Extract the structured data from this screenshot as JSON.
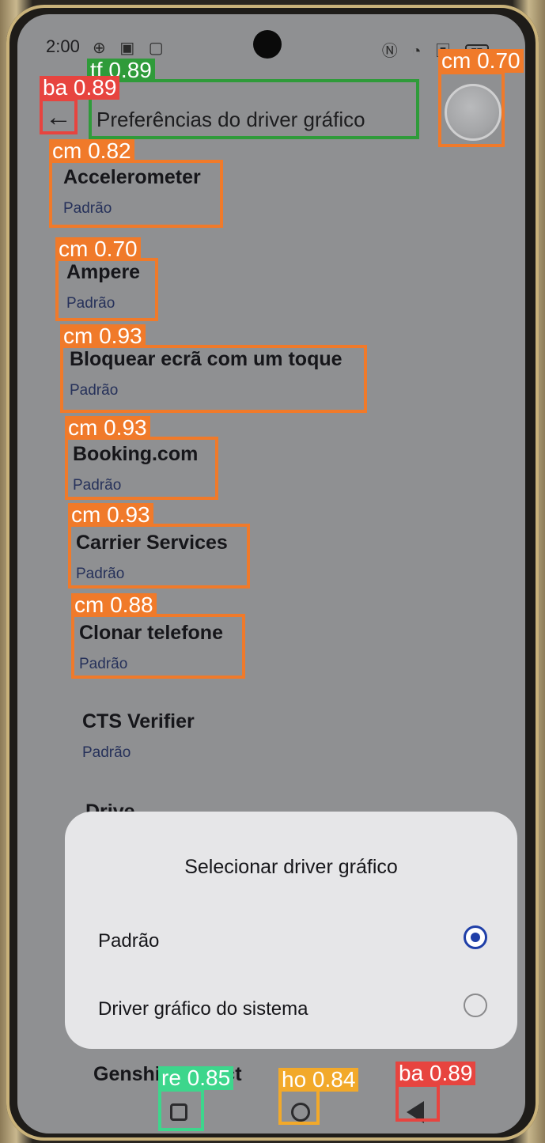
{
  "status_bar": {
    "time": "2:00",
    "left_icons": "⊕ ▣ ▢",
    "right_icons": "Ⓝ ◔ ▣",
    "battery": "77"
  },
  "header": {
    "back_icon": "←",
    "title": "Preferências do driver gráfico"
  },
  "apps": [
    {
      "name": "Accelerometer",
      "value": "Padrão"
    },
    {
      "name": "Ampere",
      "value": "Padrão"
    },
    {
      "name": "Bloquear ecrã com um toque",
      "value": "Padrão"
    },
    {
      "name": "Booking.com",
      "value": "Padrão"
    },
    {
      "name": "Carrier Services",
      "value": "Padrão"
    },
    {
      "name": "Clonar telefone",
      "value": "Padrão"
    },
    {
      "name": "CTS Verifier",
      "value": "Padrão"
    },
    {
      "name": "Drive",
      "value": ""
    },
    {
      "name": "Genshin Impact",
      "value": ""
    }
  ],
  "dialog": {
    "title": "Selecionar driver gráfico",
    "options": [
      {
        "label": "Padrão",
        "selected": true
      },
      {
        "label": "Driver gráfico do sistema",
        "selected": false
      }
    ]
  },
  "detections": [
    {
      "label": "tf 0.89"
    },
    {
      "label": "cm 0.70"
    },
    {
      "label": "ba 0.89"
    },
    {
      "label": "cm 0.82"
    },
    {
      "label": "cm 0.70"
    },
    {
      "label": "cm 0.93"
    },
    {
      "label": "cm 0.93"
    },
    {
      "label": "cm 0.93"
    },
    {
      "label": "cm 0.88"
    },
    {
      "label": "re 0.85"
    },
    {
      "label": "ho 0.84"
    },
    {
      "label": "ba 0.89"
    }
  ],
  "colors": {
    "accent": "#1f3fa8",
    "box_cm": "#f07a2a",
    "box_tf": "#2f9b3a",
    "box_ba": "#e7443f",
    "box_re": "#3dd68c",
    "box_ho": "#f2a92a"
  }
}
